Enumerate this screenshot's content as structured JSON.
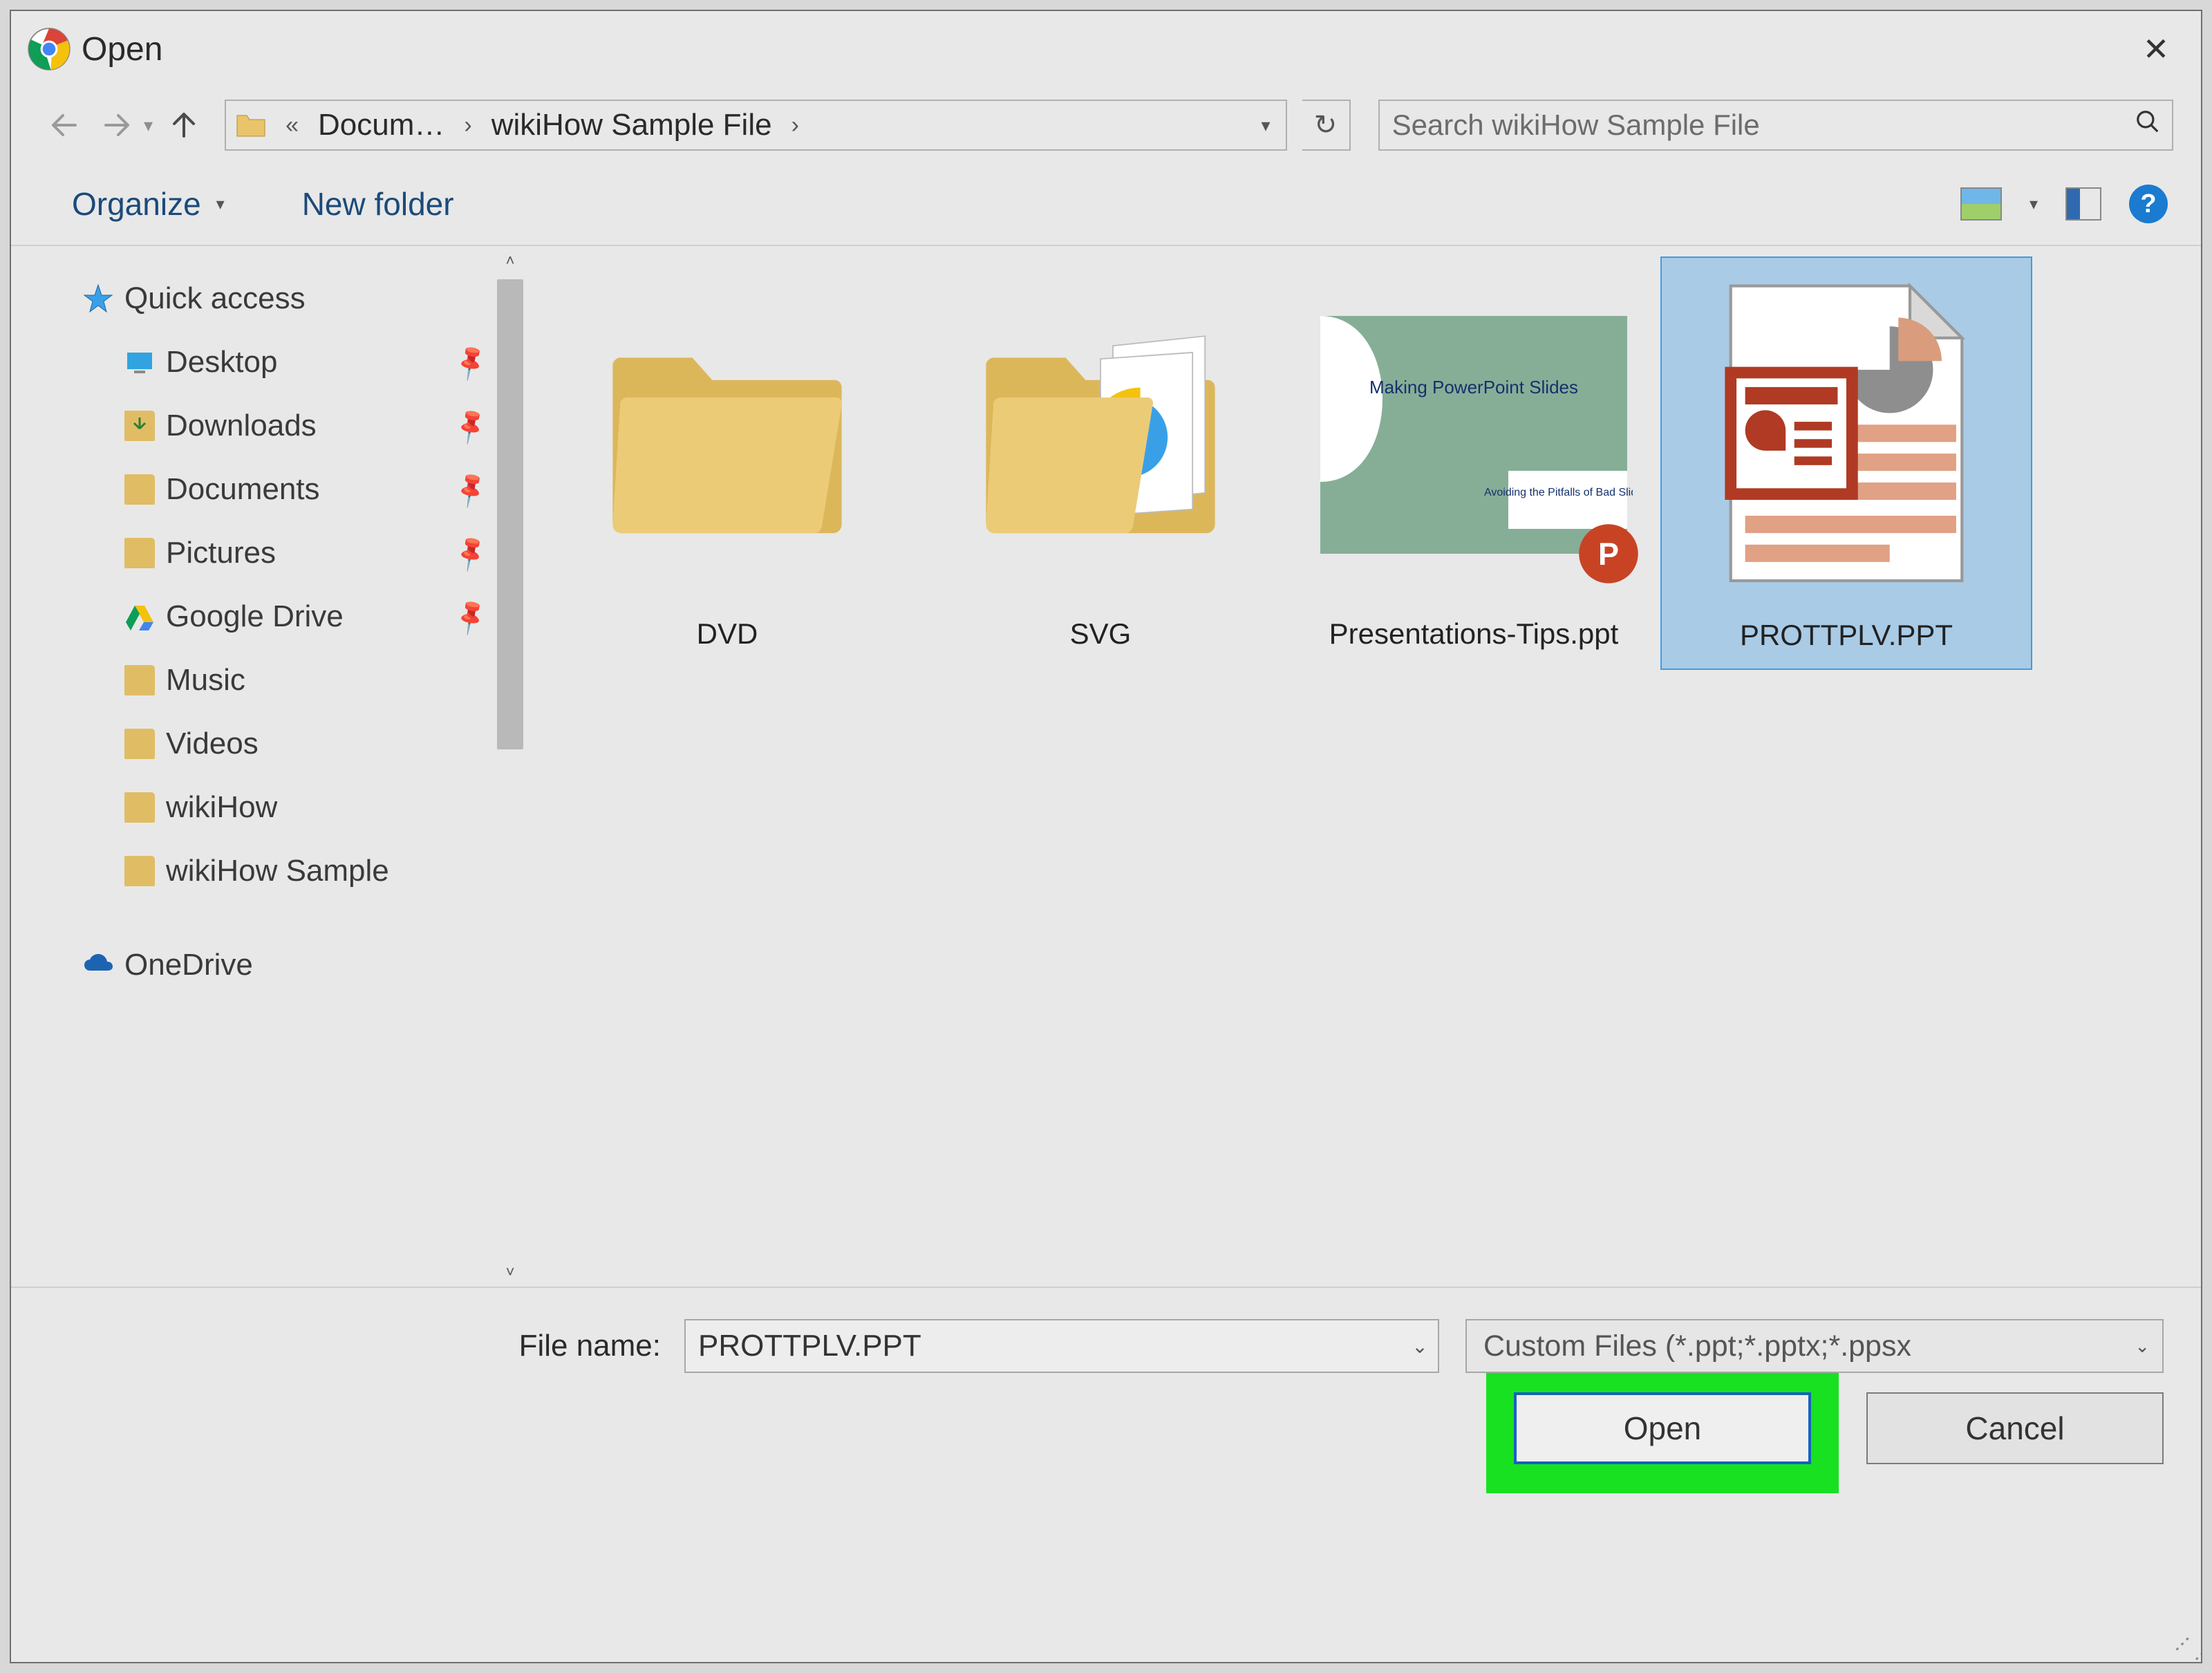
{
  "window": {
    "title": "Open"
  },
  "breadcrumb": {
    "ellipsis": "«",
    "segments": [
      "Docum…",
      "wikiHow Sample File"
    ]
  },
  "search": {
    "placeholder": "Search wikiHow Sample File"
  },
  "toolbar": {
    "organize": "Organize",
    "new_folder": "New folder"
  },
  "sidebar": {
    "quick_access": "Quick access",
    "items": [
      {
        "label": "Desktop",
        "pinned": true
      },
      {
        "label": "Downloads",
        "pinned": true
      },
      {
        "label": "Documents",
        "pinned": true
      },
      {
        "label": "Pictures",
        "pinned": true
      },
      {
        "label": "Google Drive",
        "pinned": true
      },
      {
        "label": "Music",
        "pinned": false
      },
      {
        "label": "Videos",
        "pinned": false
      },
      {
        "label": "wikiHow",
        "pinned": false
      },
      {
        "label": "wikiHow Sample",
        "pinned": false
      }
    ],
    "onedrive": "OneDrive"
  },
  "files": [
    {
      "name": "DVD",
      "type": "folder",
      "selected": false
    },
    {
      "name": "SVG",
      "type": "folder",
      "selected": false
    },
    {
      "name": "Presentations-Tips.ppt",
      "type": "ppt-thumb",
      "selected": false,
      "thumb": {
        "headline": "Making PowerPoint Slides",
        "sub": "Avoiding the Pitfalls of Bad Slides"
      }
    },
    {
      "name": "PROTTPLV.PPT",
      "type": "ppt-icon",
      "selected": true
    }
  ],
  "footer": {
    "filename_label": "File name:",
    "filename_value": "PROTTPLV.PPT",
    "filetype": "Custom Files (*.ppt;*.pptx;*.ppsx",
    "open": "Open",
    "cancel": "Cancel"
  }
}
